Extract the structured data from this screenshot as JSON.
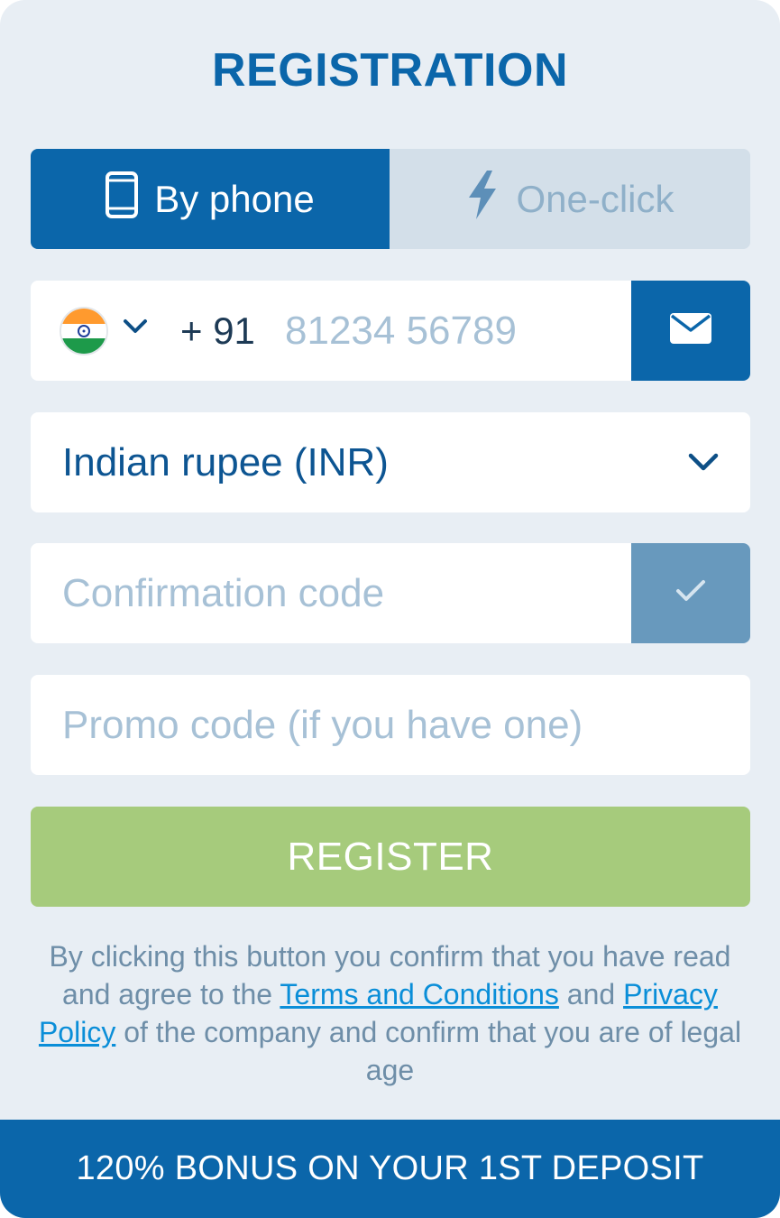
{
  "title": "REGISTRATION",
  "tabs": [
    {
      "label": "By phone",
      "icon": "phone-icon",
      "active": true
    },
    {
      "label": "One-click",
      "icon": "lightning-icon",
      "active": false
    }
  ],
  "phone": {
    "country_flag": "india-flag-icon",
    "dial_code": "+ 91",
    "placeholder": "81234 56789"
  },
  "currency": {
    "selected": "Indian rupee (INR)"
  },
  "confirmation": {
    "placeholder": "Confirmation code"
  },
  "promo": {
    "placeholder": "Promo code (if you have one)"
  },
  "register_label": "REGISTER",
  "legal": {
    "before_terms": "By clicking this button you confirm that you have read and agree to the ",
    "terms_link": "Terms and Conditions",
    "between": " and ",
    "privacy_link": "Privacy Policy",
    "after": " of the company and confirm that you are of legal age"
  },
  "bonus_banner": "120% BONUS ON YOUR 1ST DEPOSIT",
  "colors": {
    "primary": "#0b66aa",
    "background": "#e8eef4",
    "register_button": "#a6cb7c",
    "link": "#0a8ed8"
  }
}
